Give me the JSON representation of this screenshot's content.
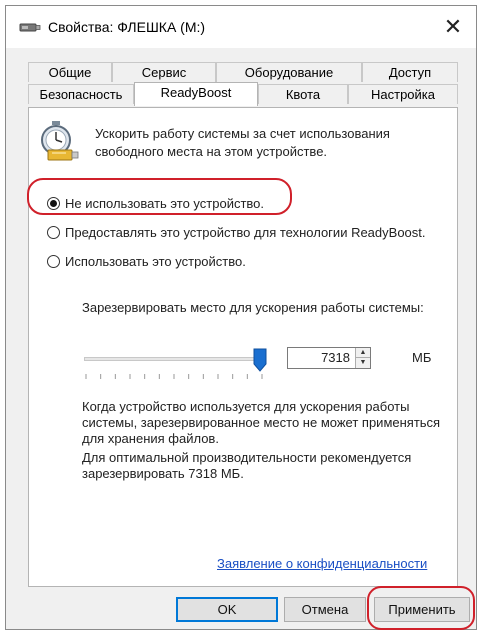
{
  "window": {
    "title": "Свойства: ФЛЕШКА (M:)",
    "close_symbol": "✕",
    "title_icon": "usb-drive-icon"
  },
  "tabs": {
    "row_top": [
      "Общие",
      "Сервис",
      "Оборудование",
      "Доступ"
    ],
    "row_bottom": [
      "Безопасность",
      "ReadyBoost",
      "Квота",
      "Настройка"
    ],
    "active": "ReadyBoost"
  },
  "readyboost": {
    "icon": "readyboost-stopwatch-icon",
    "intro": "Ускорить работу системы за счет использования свободного места на этом устройстве.",
    "options": [
      "Не использовать это устройство.",
      "Предоставлять это устройство для технологии ReadyBoost.",
      "Использовать это устройство."
    ],
    "selected_option": 0,
    "reserve_label": "Зарезервировать место для ускорения работы системы:",
    "slider_level": 1.0,
    "reserve_value": "7318",
    "unit": "МБ",
    "description_1": "Когда устройство используется для ускорения работы системы, зарезервированное место не может применяться для хранения файлов.",
    "description_2": "Для оптимальной производительности рекомендуется зарезервировать 7318 МБ.",
    "privacy_link": "Заявление о конфиденциальности"
  },
  "buttons": {
    "ok": "OK",
    "cancel": "Отмена",
    "apply": "Применить"
  },
  "colors": {
    "highlight": "#d0202a",
    "link": "#1a4fc4",
    "slider_thumb": "#1a6fd0",
    "default_button_border": "#0078d7"
  }
}
